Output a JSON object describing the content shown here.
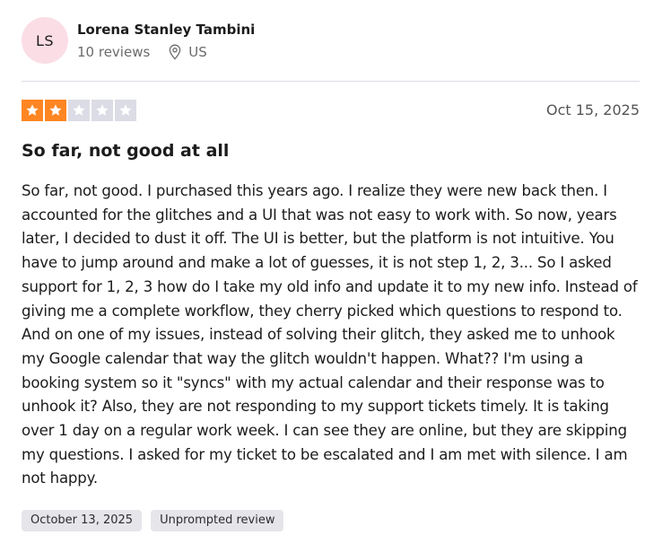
{
  "reviewer": {
    "initials": "LS",
    "name": "Lorena Stanley Tambini",
    "reviews_count": "10 reviews",
    "country": "US"
  },
  "rating": {
    "stars": 2,
    "max_stars": 5,
    "filled_color": "#ff8622",
    "empty_color": "#dcdce6"
  },
  "review": {
    "date": "Oct 15, 2025",
    "title": "So far, not good at all",
    "body": "So far, not good. I purchased this years ago. I realize they were new back then. I accounted for the glitches and a UI that was not easy to work with. So now, years later, I decided to dust it off. The UI is better, but the platform is not intuitive. You have to jump around and make a lot of guesses, it is not step 1, 2, 3... So I asked support for 1, 2, 3 how do I take my old info and update it to my new info. Instead of giving me a complete workflow, they cherry picked which questions to respond to. And on one of my issues, instead of solving their glitch, they asked me to unhook my Google calendar that way the glitch wouldn't happen. What?? I'm using a booking system so it \"syncs\" with my actual calendar and their response was to unhook it? Also, they are not responding to my support tickets timely. It is taking over 1 day on a regular work week. I can see they are online, but they are skipping my questions. I asked for my ticket to be escalated and I am met with silence. I am not happy."
  },
  "tags": {
    "experience_date": "October 13, 2025",
    "review_type": "Unprompted review"
  },
  "icons": {
    "location": "location-pin-icon",
    "star": "star-icon"
  }
}
